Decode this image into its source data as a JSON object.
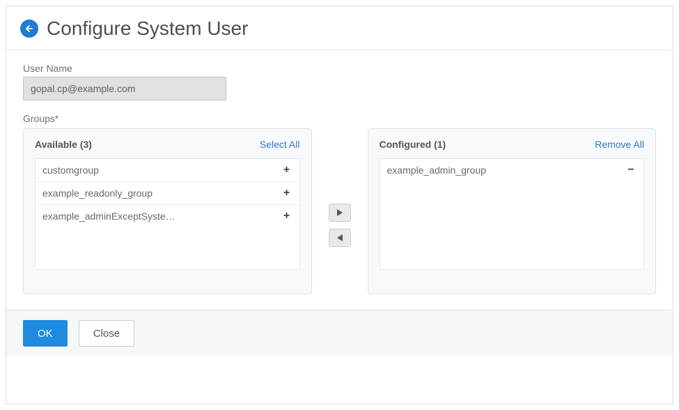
{
  "header": {
    "title": "Configure System User"
  },
  "fields": {
    "username_label": "User Name",
    "username_value": "gopal.cp@example.com",
    "groups_label": "Groups*"
  },
  "available": {
    "title": "Available (3)",
    "action": "Select All",
    "items": [
      {
        "label": "customgroup"
      },
      {
        "label": "example_readonly_group"
      },
      {
        "label": "example_adminExceptSyste…"
      }
    ]
  },
  "configured": {
    "title": "Configured (1)",
    "action": "Remove All",
    "items": [
      {
        "label": "example_admin_group"
      }
    ]
  },
  "glyphs": {
    "add": "+",
    "remove": "−"
  },
  "buttons": {
    "ok": "OK",
    "close": "Close"
  }
}
